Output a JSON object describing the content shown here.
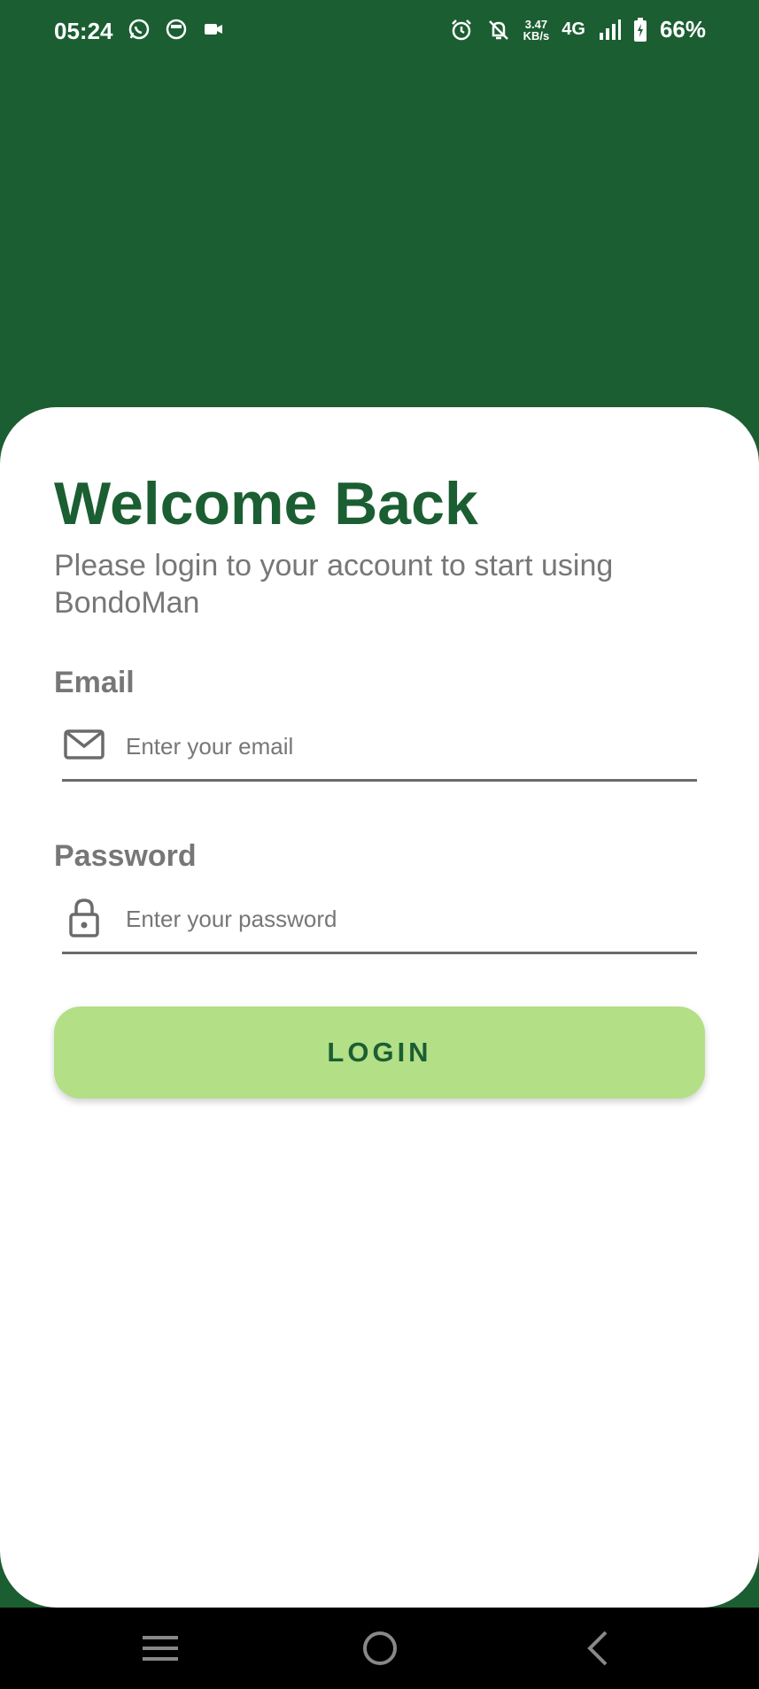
{
  "status_bar": {
    "time": "05:24",
    "left_icons": [
      "whatsapp-icon",
      "message-icon",
      "video-icon"
    ],
    "network_speed_value": "3.47",
    "network_speed_unit": "KB/s",
    "network_type": "4G",
    "battery_percent": "66%",
    "right_icons": [
      "alarm-icon",
      "bell-off-icon",
      "signal-icon",
      "battery-charging-icon"
    ]
  },
  "login": {
    "title": "Welcome Back",
    "subtitle": "Please login to your account to start using BondoMan",
    "email_label": "Email",
    "email_placeholder": "Enter your email",
    "email_value": "",
    "password_label": "Password",
    "password_placeholder": "Enter your password",
    "password_value": "",
    "button_label": "LOGIN"
  },
  "nav_bar": {
    "buttons": [
      "menu-icon",
      "home-icon",
      "back-icon"
    ]
  },
  "colors": {
    "primary_green": "#1b5e32",
    "button_green": "#b3df87",
    "text_grey": "#777777"
  }
}
